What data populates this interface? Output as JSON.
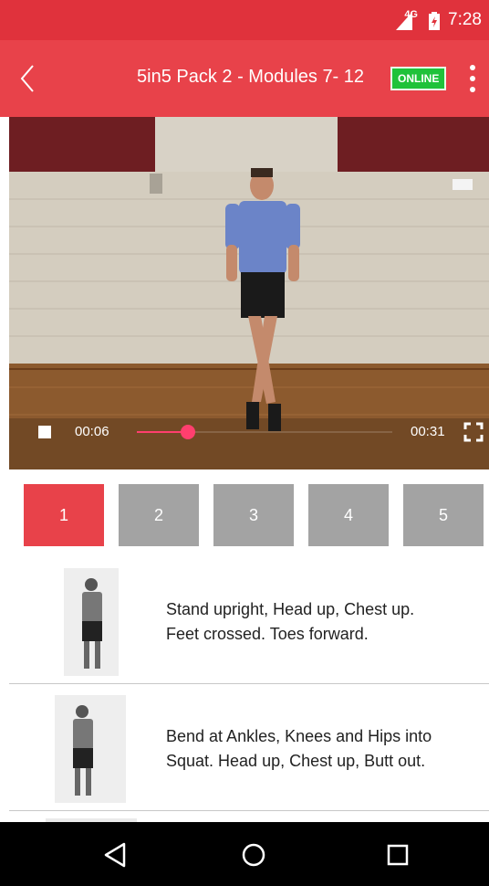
{
  "status_bar": {
    "time": "7:28",
    "network": "4G"
  },
  "app_bar": {
    "title": "5in5 Pack 2 - Modules 7- 12",
    "badge": "ONLINE",
    "color": "#e8424a",
    "badge_color": "#1fc23a"
  },
  "video": {
    "current_time": "00:06",
    "total_time": "00:31",
    "progress": 0.2,
    "accent_color": "#ff3f6e"
  },
  "tabs": [
    {
      "label": "1",
      "active": true
    },
    {
      "label": "2",
      "active": false
    },
    {
      "label": "3",
      "active": false
    },
    {
      "label": "4",
      "active": false
    },
    {
      "label": "5",
      "active": false
    }
  ],
  "steps": [
    {
      "lines": [
        "Stand upright, Head up, Chest up.",
        "Feet crossed. Toes forward."
      ]
    },
    {
      "lines": [
        "Bend at Ankles, Knees and Hips into",
        "Squat. Head up, Chest up, Butt out."
      ]
    }
  ],
  "icons": {
    "back": "back-chevron-icon",
    "more": "more-vert-icon",
    "stop": "stop-icon",
    "fullscreen": "fullscreen-icon",
    "nav": [
      "back-triangle-icon",
      "home-circle-icon",
      "recents-square-icon"
    ]
  }
}
